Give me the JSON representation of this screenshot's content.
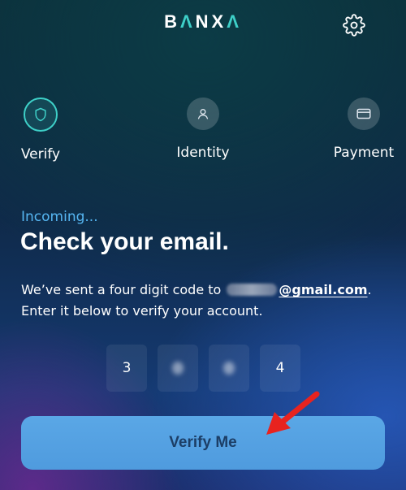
{
  "header": {
    "logo_part1": "B",
    "logo_accent1": "Λ",
    "logo_part2": "NX",
    "logo_accent2": "Λ",
    "settings_icon": "gear-icon"
  },
  "steps": [
    {
      "label": "Verify",
      "icon": "shield-icon",
      "active": true
    },
    {
      "label": "Identity",
      "icon": "user-icon",
      "active": false
    },
    {
      "label": "Payment",
      "icon": "card-icon",
      "active": false
    }
  ],
  "content": {
    "eyebrow": "Incoming...",
    "title": "Check your email.",
    "desc_prefix": "We’ve sent a four digit code to ",
    "email_domain": "@gmail.com",
    "desc_suffix": ".",
    "desc_line2": "Enter it below to verify your account."
  },
  "code": {
    "digits": [
      "3",
      "",
      "",
      "4"
    ],
    "redacted": [
      false,
      true,
      true,
      false
    ]
  },
  "actions": {
    "verify_label": "Verify Me"
  },
  "colors": {
    "accent_teal": "#3ed0c8",
    "eyebrow_blue": "#56b6f2",
    "button_blue": "#5aa7e6",
    "button_text": "#1c3e66",
    "annotation_red": "#e8231f"
  }
}
